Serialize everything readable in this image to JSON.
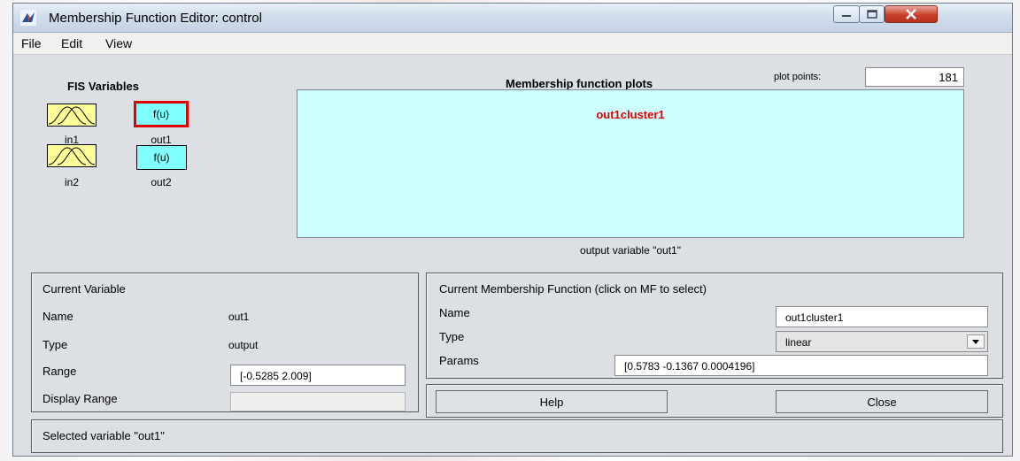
{
  "window": {
    "title": "Membership Function Editor: control",
    "app_icon": "matlab-icon",
    "controls": [
      "minimize-icon",
      "maximize-icon",
      "close-icon"
    ]
  },
  "menu": [
    "File",
    "Edit",
    "View"
  ],
  "fis": {
    "title": "FIS Variables",
    "inputs": [
      {
        "label": "in1",
        "icon": "gaussian-mf-icon"
      },
      {
        "label": "in2",
        "icon": "gaussian-mf-icon"
      }
    ],
    "outputs": [
      {
        "label": "out1",
        "box_text": "f(u)",
        "selected": true
      },
      {
        "label": "out2",
        "box_text": "f(u)",
        "selected": false
      }
    ]
  },
  "plot": {
    "header": "Membership function plots",
    "plot_points_label": "plot points:",
    "plot_points_value": "181",
    "mf_label": "out1cluster1",
    "caption": "output variable \"out1\""
  },
  "current_variable": {
    "title": "Current Variable",
    "name_label": "Name",
    "name_value": "out1",
    "type_label": "Type",
    "type_value": "output",
    "range_label": "Range",
    "range_value": "[-0.5285 2.009]",
    "display_range_label": "Display Range",
    "display_range_value": ""
  },
  "current_mf": {
    "title": "Current Membership Function (click on MF to select)",
    "name_label": "Name",
    "name_value": "out1cluster1",
    "type_label": "Type",
    "type_value": "linear",
    "params_label": "Params",
    "params_value": "[0.5783 -0.1367 0.0004196]"
  },
  "buttons": {
    "help": "Help",
    "close": "Close"
  },
  "status": "Selected variable \"out1\"",
  "colors": {
    "input_box": "#ffff99",
    "output_box": "#7fffff",
    "plot_bg": "#ccffff",
    "selection": "#e00000",
    "mf_label": "#e00000"
  }
}
